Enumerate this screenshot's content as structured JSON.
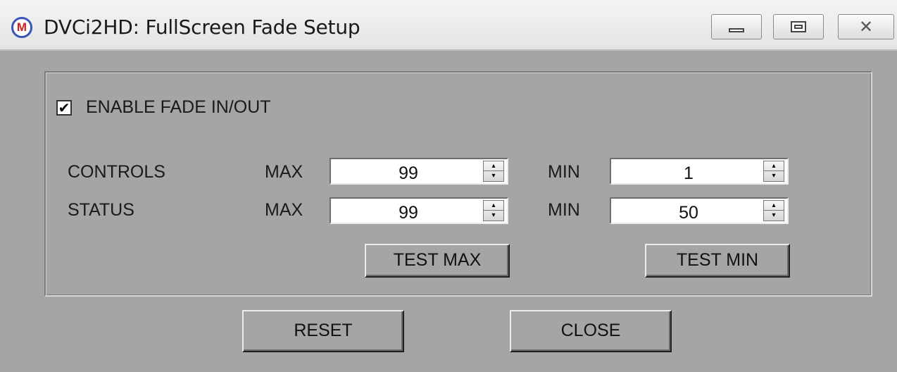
{
  "window": {
    "title": "DVCi2HD: FullScreen Fade Setup",
    "icon_letter": "M",
    "close_glyph": "✕",
    "controls": [
      "minimize",
      "maximize",
      "close"
    ]
  },
  "enable": {
    "label": "ENABLE FADE IN/OUT",
    "checked": true,
    "check_glyph": "✔"
  },
  "rows": [
    {
      "label": "CONTROLS",
      "max_label": "MAX",
      "max_value": "99",
      "min_label": "MIN",
      "min_value": "1"
    },
    {
      "label": "STATUS",
      "max_label": "MAX",
      "max_value": "99",
      "min_label": "MIN",
      "min_value": "50"
    }
  ],
  "spin_glyphs": {
    "up": "▴",
    "down": "▾"
  },
  "buttons": {
    "test_max": "TEST MAX",
    "test_min": "TEST MIN",
    "reset": "RESET",
    "close": "CLOSE"
  },
  "colors": {
    "window_bg": "#a5a5a5",
    "titlebar_bg": "#ececec",
    "icon_ring": "#3a55b5",
    "icon_letter": "#d41d1d"
  }
}
